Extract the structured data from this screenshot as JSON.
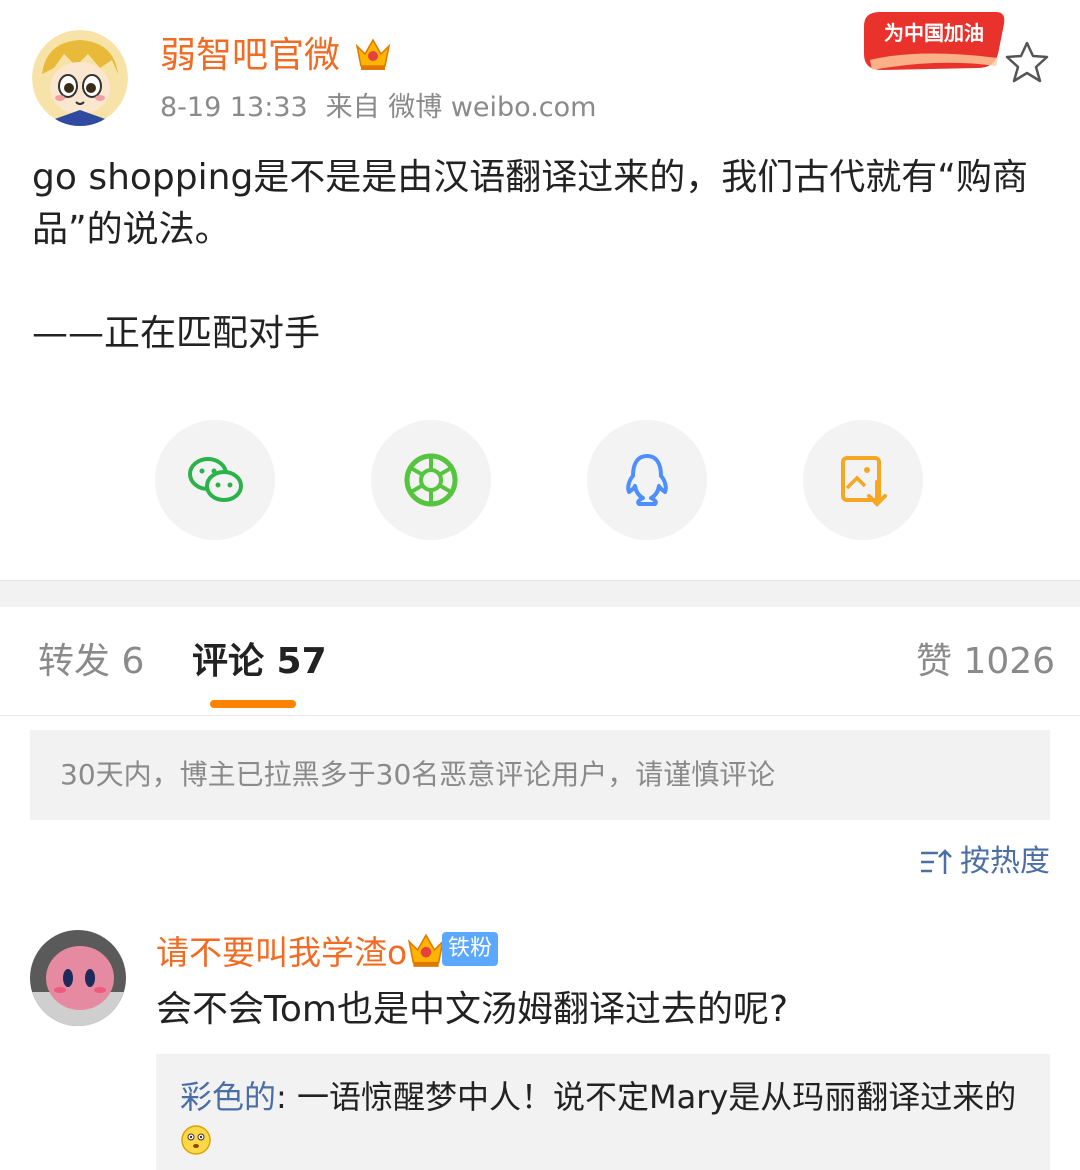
{
  "post": {
    "username": "弱智吧官微",
    "time": "8-19 13:33",
    "source": "来自 微博 weibo.com",
    "badge_text": "为中国加油",
    "content_line1": "go shopping是不是是由汉语翻译过来的，我们古代就有“购商品”的说法。",
    "content_line2": "——正在匹配对手"
  },
  "share": {
    "items": [
      "wechat-icon",
      "moments-icon",
      "qq-icon",
      "save-image-icon"
    ],
    "colors": {
      "wechat": "#2bb34a",
      "moments": "#55c43e",
      "qq": "#4d8fff",
      "save": "#f5a623"
    }
  },
  "tabs": {
    "repost": "转发 6",
    "comment": "评论 57",
    "like": "赞 1026"
  },
  "notice": "30天内，博主已拉黑多于30名恶意评论用户，请谨慎评论",
  "sort_label": "按热度",
  "comment": {
    "username": "请不要叫我学渣o",
    "fan_badge": "铁粉",
    "text": "会不会Tom也是中文汤姆翻译过去的呢?",
    "reply_name": "彩色的",
    "reply_text": ": 一语惊醒梦中人！说不定Mary是从玛丽翻译过来的"
  },
  "colors": {
    "accent": "#ff8200",
    "username": "#f26b23",
    "link": "#4a6fa5"
  }
}
